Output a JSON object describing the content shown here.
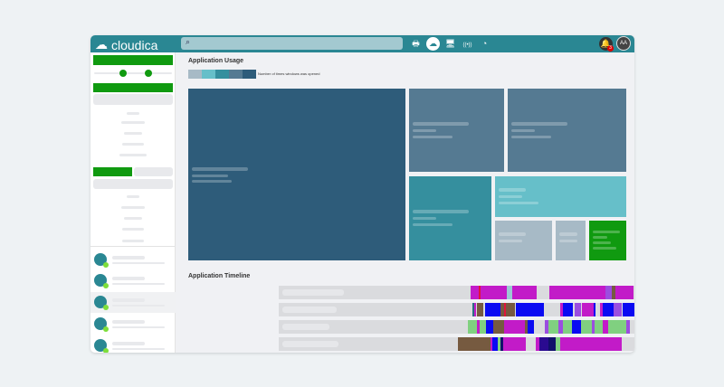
{
  "app": {
    "name": "cloudica"
  },
  "header": {
    "search_icon": "search-icon",
    "nav": [
      {
        "name": "printer-icon",
        "glyph": "🖶",
        "active": false
      },
      {
        "name": "cloud-icon",
        "glyph": "☁",
        "active": true
      },
      {
        "name": "monitor-icon",
        "glyph": "🖥",
        "active": false
      },
      {
        "name": "broadcast-icon",
        "glyph": "((•))",
        "active": false
      },
      {
        "name": "clock-user-icon",
        "glyph": "◔",
        "active": false
      }
    ],
    "notification_count": "3",
    "avatar_initials": "AA"
  },
  "usage": {
    "title": "Application Usage",
    "legend_label": "Number of times windows was opened",
    "legend_colors": [
      "#a7bac6",
      "#66bfc9",
      "#358f9e",
      "#557a92",
      "#2e5c7a"
    ]
  },
  "timeline": {
    "title": "Application Timeline",
    "colors": {
      "magenta": "#c21bc8",
      "red": "#e0143c",
      "lightblue": "#9cc8d4",
      "purple": "#9b4de0",
      "brown": "#765a40",
      "teal": "#2a6f80",
      "blue": "#0a0af2",
      "green": "#80d080",
      "navy": "#10106a",
      "indigo": "#2a0a90"
    },
    "rows": [
      [
        [
          "magenta",
          43.8,
          58.9
        ],
        [
          "red",
          45.7,
          46.1
        ],
        [
          "lightblue",
          52.1,
          53.3
        ],
        [
          "magenta",
          61.8,
          81.0
        ],
        [
          "purple",
          74.6,
          76.0
        ],
        [
          "brown",
          76.0,
          76.9
        ]
      ],
      [
        [
          "teal",
          44.2,
          44.6
        ],
        [
          "magenta",
          44.6,
          45.0
        ],
        [
          "brown",
          45.2,
          46.7
        ],
        [
          "blue",
          47.1,
          50.6
        ],
        [
          "brown",
          50.6,
          53.9
        ],
        [
          "red",
          51.4,
          51.9
        ],
        [
          "blue",
          54.1,
          60.5
        ],
        [
          "magenta",
          64.3,
          64.9
        ],
        [
          "blue",
          64.9,
          67.1
        ],
        [
          "purple",
          67.6,
          69.0
        ],
        [
          "magenta",
          69.2,
          71.9
        ],
        [
          "blue",
          71.9,
          72.3
        ],
        [
          "magenta",
          73.3,
          74.0
        ],
        [
          "blue",
          74.0,
          76.4
        ],
        [
          "purple",
          76.4,
          78.3
        ],
        [
          "blue",
          78.5,
          84.1
        ],
        [
          "green",
          84.1,
          84.5
        ],
        [
          "purple",
          84.5,
          85.7
        ]
      ],
      [
        [
          "green",
          43.2,
          45.2
        ],
        [
          "magenta",
          45.2,
          45.9
        ],
        [
          "green",
          45.9,
          47.3
        ],
        [
          "blue",
          47.3,
          49.0
        ],
        [
          "brown",
          49.0,
          51.4
        ],
        [
          "magenta",
          51.4,
          56.2
        ],
        [
          "brown",
          56.2,
          56.8
        ],
        [
          "blue",
          56.8,
          58.3
        ],
        [
          "purple",
          60.7,
          61.6
        ],
        [
          "green",
          61.6,
          63.8
        ],
        [
          "purple",
          63.8,
          64.9
        ],
        [
          "green",
          64.9,
          66.9
        ],
        [
          "blue",
          66.9,
          69.0
        ],
        [
          "green",
          69.0,
          71.5
        ],
        [
          "purple",
          71.5,
          72.1
        ],
        [
          "green",
          72.1,
          74.0
        ],
        [
          "magenta",
          74.0,
          75.2
        ],
        [
          "green",
          75.2,
          79.3
        ],
        [
          "purple",
          79.3,
          80.2
        ]
      ],
      [
        [
          "brown",
          40.9,
          48.3
        ],
        [
          "magenta",
          48.3,
          48.8
        ],
        [
          "blue",
          48.8,
          50.0
        ],
        [
          "green",
          50.0,
          50.6
        ],
        [
          "navy",
          50.6,
          51.2
        ],
        [
          "magenta",
          51.2,
          56.4
        ],
        [
          "magenta",
          58.7,
          59.5
        ],
        [
          "indigo",
          59.5,
          61.6
        ],
        [
          "navy",
          61.6,
          63.2
        ],
        [
          "green",
          63.2,
          64.3
        ],
        [
          "magenta",
          64.3,
          78.3
        ]
      ]
    ]
  }
}
